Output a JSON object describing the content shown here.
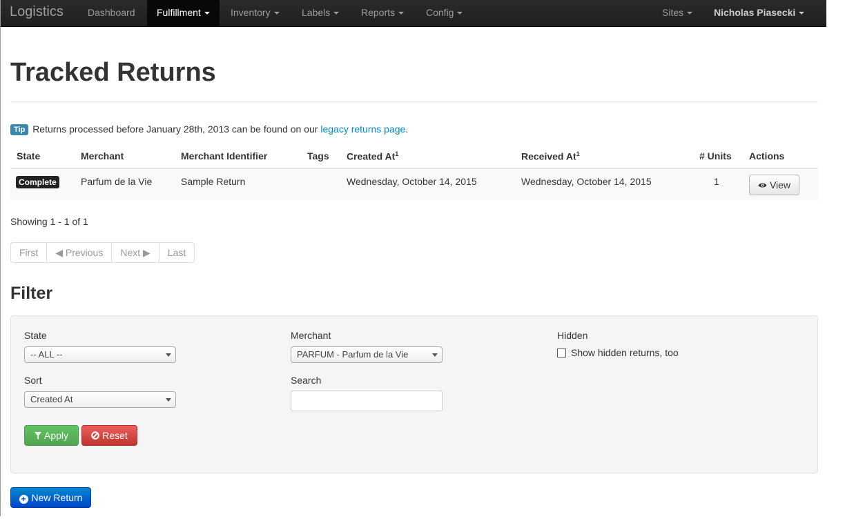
{
  "navbar": {
    "brand": "Logistics",
    "items": [
      {
        "label": "Dashboard"
      },
      {
        "label": "Fulfillment"
      },
      {
        "label": "Inventory"
      },
      {
        "label": "Labels"
      },
      {
        "label": "Reports"
      },
      {
        "label": "Config"
      }
    ],
    "sites": "Sites",
    "user": "Nicholas Piasecki"
  },
  "page_title": "Tracked Returns",
  "tip": {
    "badge": "Tip",
    "text": "Returns processed before January 28th, 2013 can be found on our",
    "link": "legacy returns page",
    "after": "."
  },
  "table": {
    "headers": [
      "State",
      "Merchant",
      "Merchant Identifier",
      "Tags",
      "Created At",
      "Received At",
      "# Units",
      "Actions"
    ],
    "footnote_mark": "1",
    "rows": [
      {
        "state": "Complete",
        "merchant": "Parfum de la Vie",
        "identifier": "Sample Return",
        "tags": "",
        "created_at": "Wednesday, October 14, 2015",
        "received_at": "Wednesday, October 14, 2015",
        "units": "1",
        "action": "View"
      }
    ]
  },
  "showing": "Showing 1 - 1 of 1",
  "pager": {
    "first": "First",
    "previous": "◀ Previous",
    "next": "Next ▶",
    "last": "Last"
  },
  "filter": {
    "heading": "Filter",
    "state_label": "State",
    "state_value": "-- ALL --",
    "merchant_label": "Merchant",
    "merchant_value": "PARFUM - Parfum de la Vie",
    "hidden_label": "Hidden",
    "hidden_checkbox_label": "Show hidden returns, too",
    "sort_label": "Sort",
    "sort_value": "Created At",
    "search_label": "Search",
    "search_value": "",
    "apply": "Apply",
    "reset": "Reset"
  },
  "new_return": "New Return"
}
